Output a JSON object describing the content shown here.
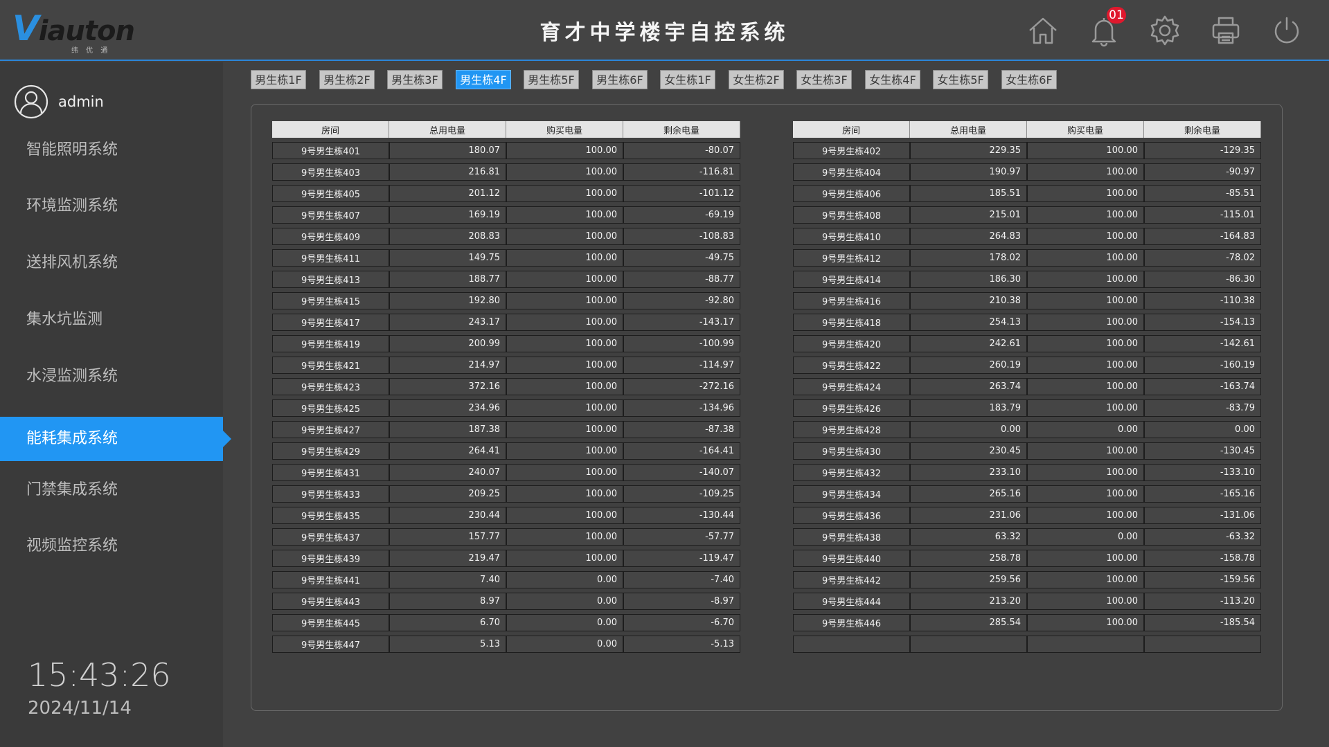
{
  "header": {
    "logo_text_v": "V",
    "logo_text_rest": "iauton",
    "logo_sub": "纬 优 通",
    "title": "育才中学楼宇自控系统",
    "notification_count": "01",
    "icons": [
      "home-icon",
      "bell-icon",
      "gear-icon",
      "printer-icon",
      "power-icon"
    ]
  },
  "sidebar": {
    "username": "admin",
    "items": [
      {
        "label": "智能照明系统",
        "active": false
      },
      {
        "label": "环境监测系统",
        "active": false
      },
      {
        "label": "送排风机系统",
        "active": false
      },
      {
        "label": "集水坑监测",
        "active": false
      },
      {
        "label": "水浸监测系统",
        "active": false
      },
      {
        "label": "能耗集成系统",
        "active": true
      },
      {
        "label": "门禁集成系统",
        "active": false
      },
      {
        "label": "视频监控系统",
        "active": false
      }
    ],
    "time": "15:43:26",
    "date": "2024/11/14"
  },
  "tabs": [
    {
      "label": "男生栋1F",
      "active": false
    },
    {
      "label": "男生栋2F",
      "active": false
    },
    {
      "label": "男生栋3F",
      "active": false
    },
    {
      "label": "男生栋4F",
      "active": true
    },
    {
      "label": "男生栋5F",
      "active": false
    },
    {
      "label": "男生栋6F",
      "active": false
    },
    {
      "label": "女生栋1F",
      "active": false
    },
    {
      "label": "女生栋2F",
      "active": false
    },
    {
      "label": "女生栋3F",
      "active": false
    },
    {
      "label": "女生栋4F",
      "active": false
    },
    {
      "label": "女生栋5F",
      "active": false
    },
    {
      "label": "女生栋6F",
      "active": false
    }
  ],
  "table": {
    "headers": [
      "房间",
      "总用电量",
      "购买电量",
      "剩余电量"
    ],
    "left_rows": [
      [
        "9号男生栋401",
        "180.07",
        "100.00",
        "-80.07"
      ],
      [
        "9号男生栋403",
        "216.81",
        "100.00",
        "-116.81"
      ],
      [
        "9号男生栋405",
        "201.12",
        "100.00",
        "-101.12"
      ],
      [
        "9号男生栋407",
        "169.19",
        "100.00",
        "-69.19"
      ],
      [
        "9号男生栋409",
        "208.83",
        "100.00",
        "-108.83"
      ],
      [
        "9号男生栋411",
        "149.75",
        "100.00",
        "-49.75"
      ],
      [
        "9号男生栋413",
        "188.77",
        "100.00",
        "-88.77"
      ],
      [
        "9号男生栋415",
        "192.80",
        "100.00",
        "-92.80"
      ],
      [
        "9号男生栋417",
        "243.17",
        "100.00",
        "-143.17"
      ],
      [
        "9号男生栋419",
        "200.99",
        "100.00",
        "-100.99"
      ],
      [
        "9号男生栋421",
        "214.97",
        "100.00",
        "-114.97"
      ],
      [
        "9号男生栋423",
        "372.16",
        "100.00",
        "-272.16"
      ],
      [
        "9号男生栋425",
        "234.96",
        "100.00",
        "-134.96"
      ],
      [
        "9号男生栋427",
        "187.38",
        "100.00",
        "-87.38"
      ],
      [
        "9号男生栋429",
        "264.41",
        "100.00",
        "-164.41"
      ],
      [
        "9号男生栋431",
        "240.07",
        "100.00",
        "-140.07"
      ],
      [
        "9号男生栋433",
        "209.25",
        "100.00",
        "-109.25"
      ],
      [
        "9号男生栋435",
        "230.44",
        "100.00",
        "-130.44"
      ],
      [
        "9号男生栋437",
        "157.77",
        "100.00",
        "-57.77"
      ],
      [
        "9号男生栋439",
        "219.47",
        "100.00",
        "-119.47"
      ],
      [
        "9号男生栋441",
        "7.40",
        "0.00",
        "-7.40"
      ],
      [
        "9号男生栋443",
        "8.97",
        "0.00",
        "-8.97"
      ],
      [
        "9号男生栋445",
        "6.70",
        "0.00",
        "-6.70"
      ],
      [
        "9号男生栋447",
        "5.13",
        "0.00",
        "-5.13"
      ]
    ],
    "right_rows": [
      [
        "9号男生栋402",
        "229.35",
        "100.00",
        "-129.35"
      ],
      [
        "9号男生栋404",
        "190.97",
        "100.00",
        "-90.97"
      ],
      [
        "9号男生栋406",
        "185.51",
        "100.00",
        "-85.51"
      ],
      [
        "9号男生栋408",
        "215.01",
        "100.00",
        "-115.01"
      ],
      [
        "9号男生栋410",
        "264.83",
        "100.00",
        "-164.83"
      ],
      [
        "9号男生栋412",
        "178.02",
        "100.00",
        "-78.02"
      ],
      [
        "9号男生栋414",
        "186.30",
        "100.00",
        "-86.30"
      ],
      [
        "9号男生栋416",
        "210.38",
        "100.00",
        "-110.38"
      ],
      [
        "9号男生栋418",
        "254.13",
        "100.00",
        "-154.13"
      ],
      [
        "9号男生栋420",
        "242.61",
        "100.00",
        "-142.61"
      ],
      [
        "9号男生栋422",
        "260.19",
        "100.00",
        "-160.19"
      ],
      [
        "9号男生栋424",
        "263.74",
        "100.00",
        "-163.74"
      ],
      [
        "9号男生栋426",
        "183.79",
        "100.00",
        "-83.79"
      ],
      [
        "9号男生栋428",
        "0.00",
        "0.00",
        "0.00"
      ],
      [
        "9号男生栋430",
        "230.45",
        "100.00",
        "-130.45"
      ],
      [
        "9号男生栋432",
        "233.10",
        "100.00",
        "-133.10"
      ],
      [
        "9号男生栋434",
        "265.16",
        "100.00",
        "-165.16"
      ],
      [
        "9号男生栋436",
        "231.06",
        "100.00",
        "-131.06"
      ],
      [
        "9号男生栋438",
        "63.32",
        "0.00",
        "-63.32"
      ],
      [
        "9号男生栋440",
        "258.78",
        "100.00",
        "-158.78"
      ],
      [
        "9号男生栋442",
        "259.56",
        "100.00",
        "-159.56"
      ],
      [
        "9号男生栋444",
        "213.20",
        "100.00",
        "-113.20"
      ],
      [
        "9号男生栋446",
        "285.54",
        "100.00",
        "-185.54"
      ],
      [
        "",
        "",
        "",
        ""
      ]
    ]
  }
}
